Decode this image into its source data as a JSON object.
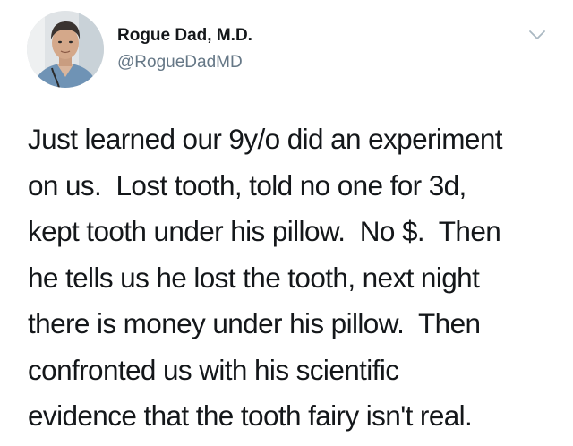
{
  "author": {
    "display_name": "Rogue Dad, M.D.",
    "handle": "@RogueDadMD",
    "avatar_icon": "profile-photo"
  },
  "menu": {
    "icon": "chevron-down-icon"
  },
  "tweet": {
    "lines": [
      "Just learned our 9y/o did an experiment",
      "on us.  Lost tooth, told no one for 3d,",
      "kept tooth under his pillow.  No $.  Then",
      "he tells us he lost the tooth, next night",
      "there is money under his pillow.  Then",
      "confronted us with his scientific",
      "evidence that the tooth fairy isn't real."
    ]
  },
  "colors": {
    "text": "#14171a",
    "secondary": "#657786",
    "background": "#ffffff"
  }
}
